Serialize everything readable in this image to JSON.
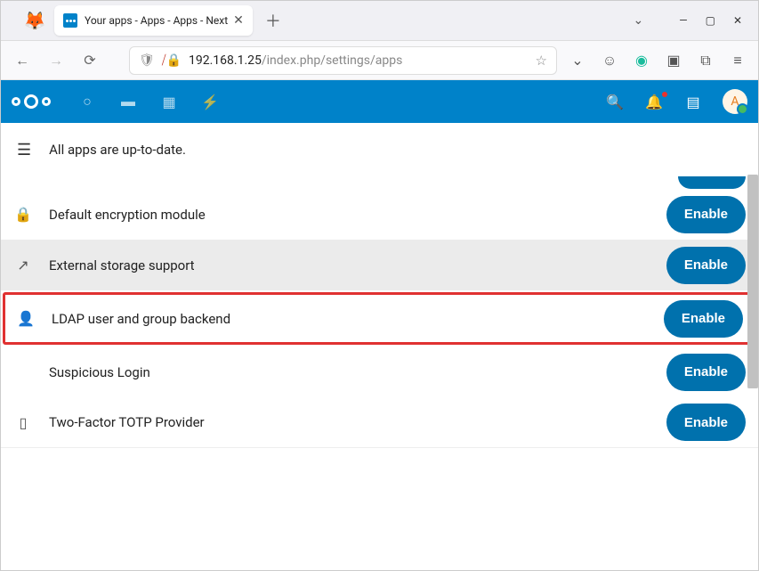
{
  "browser": {
    "tab_title": "Your apps - Apps - Apps - Next",
    "url_host": "192.168.1.25",
    "url_path": "/index.php/settings/apps"
  },
  "header": {
    "status": "All apps are up-to-date."
  },
  "avatar": {
    "initial": "A"
  },
  "enable_label": "Enable",
  "apps": [
    {
      "name": "Default encryption module",
      "icon": "🔒"
    },
    {
      "name": "External storage support",
      "icon": "↗"
    },
    {
      "name": "LDAP user and group backend",
      "icon": "👤"
    },
    {
      "name": "Suspicious Login",
      "icon": ""
    },
    {
      "name": "Two-Factor TOTP Provider",
      "icon": "▯"
    }
  ]
}
